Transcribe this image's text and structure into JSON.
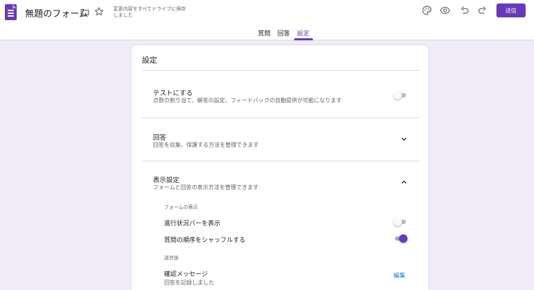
{
  "header": {
    "form_title": "無題のフォーム",
    "save_status": "変更内容をすべてドライブに保存しました",
    "send_label": "送信",
    "icons": [
      "forms-app-icon",
      "folder-icon",
      "star-icon",
      "palette-icon",
      "preview-eye-icon",
      "undo-icon",
      "redo-icon"
    ]
  },
  "tabs": [
    {
      "label": "質問"
    },
    {
      "label": "回答"
    },
    {
      "label": "設定",
      "active": true
    }
  ],
  "settings": {
    "title": "設定",
    "quiz": {
      "title": "テストにする",
      "desc": "点数の割り当て、解答の設定、フィードバックの自動提供が可能になります",
      "enabled": false
    },
    "responses": {
      "title": "回答",
      "desc": "回答を収集、保護する方法を管理できます",
      "expanded": false
    },
    "presentation": {
      "title": "表示設定",
      "desc": "フォームと回答の表示方法を管理できます",
      "expanded": true,
      "form_display_heading": "フォームの表示",
      "progress_bar": {
        "label": "進行状況バーを表示",
        "enabled": false
      },
      "shuffle": {
        "label": "質問の順序をシャッフルする",
        "enabled": true
      },
      "after_submit_heading": "送信後",
      "confirmation": {
        "label": "確認メッセージ",
        "value": "回答を記録しました",
        "edit_label": "編集"
      }
    }
  },
  "colors": {
    "accent": "#673ab7",
    "background": "#f0ebf8",
    "link": "#1a73e8"
  }
}
